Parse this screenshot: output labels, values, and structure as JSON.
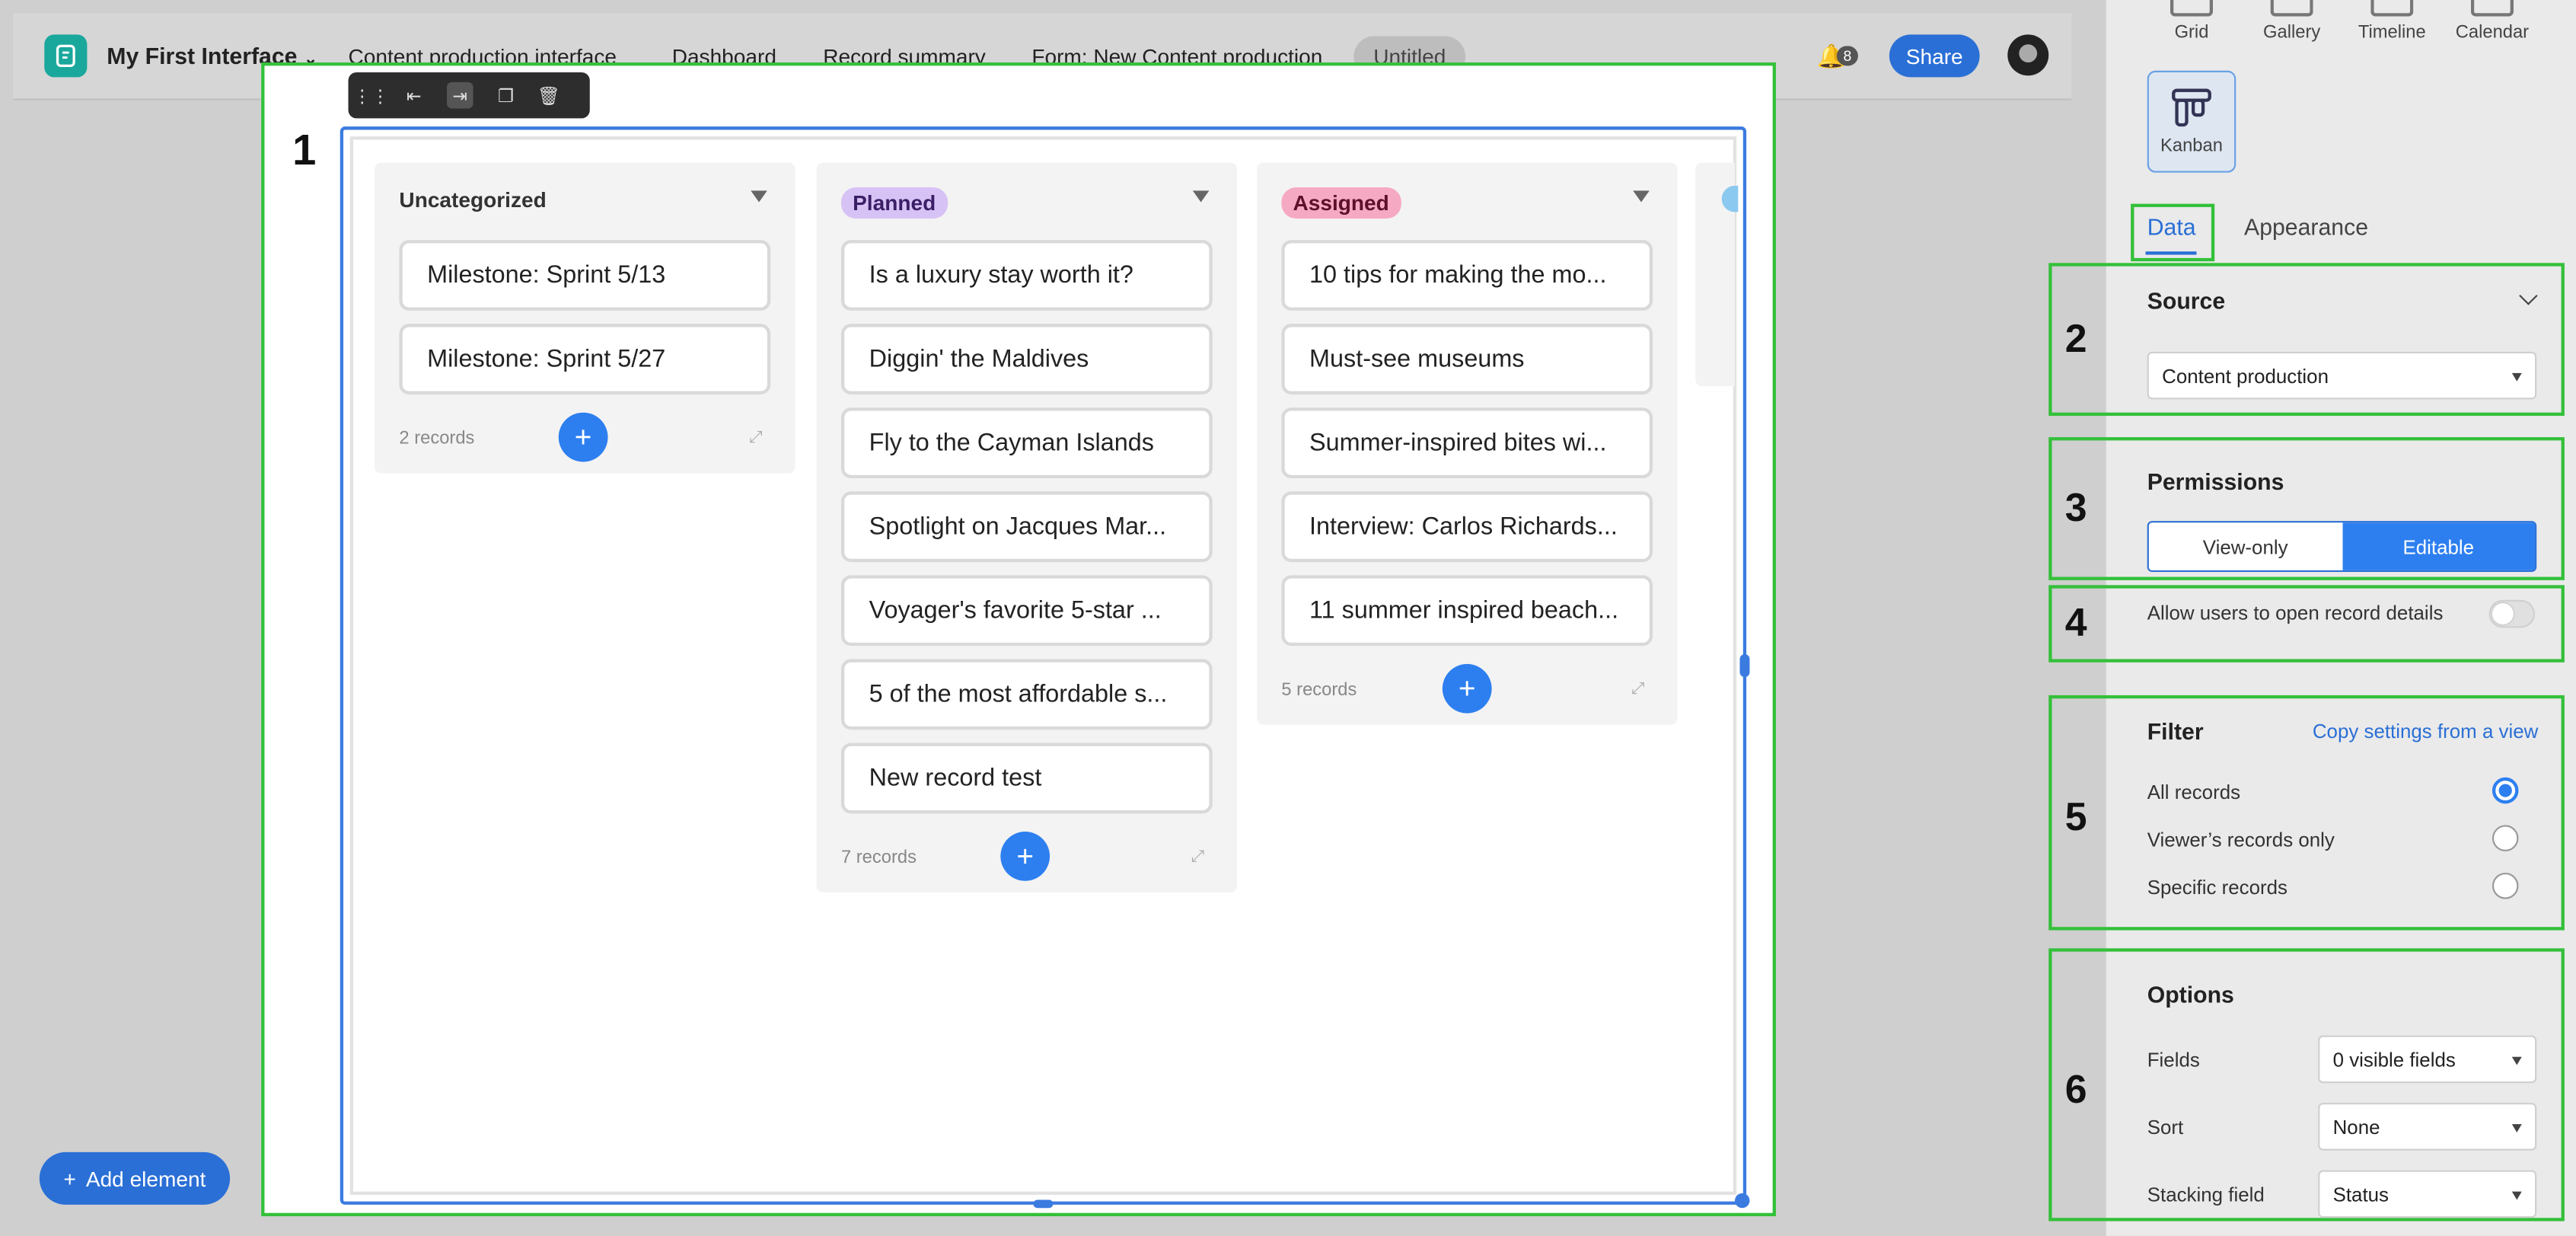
{
  "header": {
    "app_title": "My First Interface",
    "nav": [
      "Content production interface",
      "Dashboard",
      "Record summary",
      "Form: New Content production",
      "Untitled"
    ],
    "notification_count": "8",
    "share_label": "Share"
  },
  "canvas": {
    "block_number": "1",
    "add_element_label": "Add element"
  },
  "kanban": {
    "columns": [
      {
        "title": "Uncategorized",
        "cards": [
          "Milestone: Sprint 5/13",
          "Milestone: Sprint 5/27"
        ],
        "count_label": "2 records"
      },
      {
        "title": "Planned",
        "color": "#d7c2f5",
        "cards": [
          "Is a luxury stay worth it?",
          "Diggin' the Maldives",
          "Fly to the Cayman Islands",
          "Spotlight on Jacques Mar...",
          "Voyager's favorite 5-star ...",
          "5 of the most affordable s...",
          "New record test"
        ],
        "count_label": "7 records"
      },
      {
        "title": "Assigned",
        "color": "#f6a9c2",
        "cards": [
          "10 tips for making the mo...",
          "Must-see museums",
          "Summer-inspired bites wi...",
          "Interview: Carlos Richards...",
          "11 summer inspired beach..."
        ],
        "count_label": "5 records"
      }
    ]
  },
  "panel": {
    "view_types": [
      "Grid",
      "Gallery",
      "Timeline",
      "Calendar"
    ],
    "selected_view": "Kanban",
    "tabs": [
      "Data",
      "Appearance"
    ],
    "sections": {
      "source": {
        "num": "2",
        "title": "Source",
        "value": "Content production"
      },
      "permissions": {
        "num": "3",
        "title": "Permissions",
        "options": [
          "View-only",
          "Editable"
        ]
      },
      "record_details": {
        "num": "4",
        "label": "Allow users to open record details"
      },
      "filter": {
        "num": "5",
        "title": "Filter",
        "link": "Copy settings from a view",
        "options": [
          "All records",
          "Viewer’s records only",
          "Specific records"
        ]
      },
      "options": {
        "num": "6",
        "title": "Options",
        "fields_label": "Fields",
        "fields_value": "0 visible fields",
        "sort_label": "Sort",
        "sort_value": "None",
        "stacking_label": "Stacking field",
        "stacking_value": "Status"
      }
    }
  },
  "colors": {
    "accent": "#2a6fd6",
    "highlight": "#34c03a",
    "teal": "#1aa89c"
  }
}
